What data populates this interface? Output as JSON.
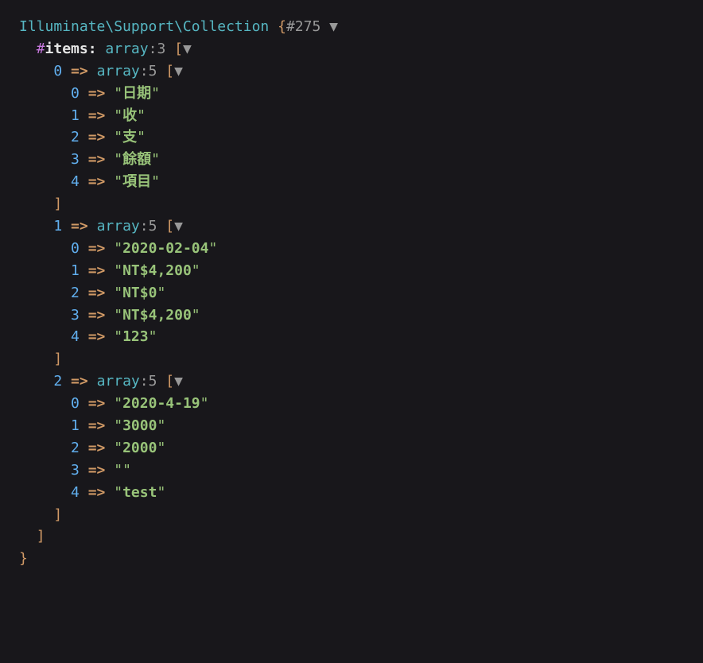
{
  "className": "Illuminate\\Support\\Collection",
  "objectId": "#275",
  "toggleGlyph": "▼",
  "itemsLabel": "items",
  "arrayType": "array",
  "topCount": "3",
  "subCount": "5",
  "rows": [
    {
      "index": "0",
      "values": [
        {
          "key": "0",
          "val": "日期"
        },
        {
          "key": "1",
          "val": "收"
        },
        {
          "key": "2",
          "val": "支"
        },
        {
          "key": "3",
          "val": "餘額"
        },
        {
          "key": "4",
          "val": "項目"
        }
      ]
    },
    {
      "index": "1",
      "values": [
        {
          "key": "0",
          "val": "2020-02-04"
        },
        {
          "key": "1",
          "val": "NT$4,200"
        },
        {
          "key": "2",
          "val": "NT$0"
        },
        {
          "key": "3",
          "val": "NT$4,200"
        },
        {
          "key": "4",
          "val": "123"
        }
      ]
    },
    {
      "index": "2",
      "values": [
        {
          "key": "0",
          "val": "2020-4-19"
        },
        {
          "key": "1",
          "val": "3000"
        },
        {
          "key": "2",
          "val": "2000"
        },
        {
          "key": "3",
          "val": ""
        },
        {
          "key": "4",
          "val": "test"
        }
      ]
    }
  ]
}
